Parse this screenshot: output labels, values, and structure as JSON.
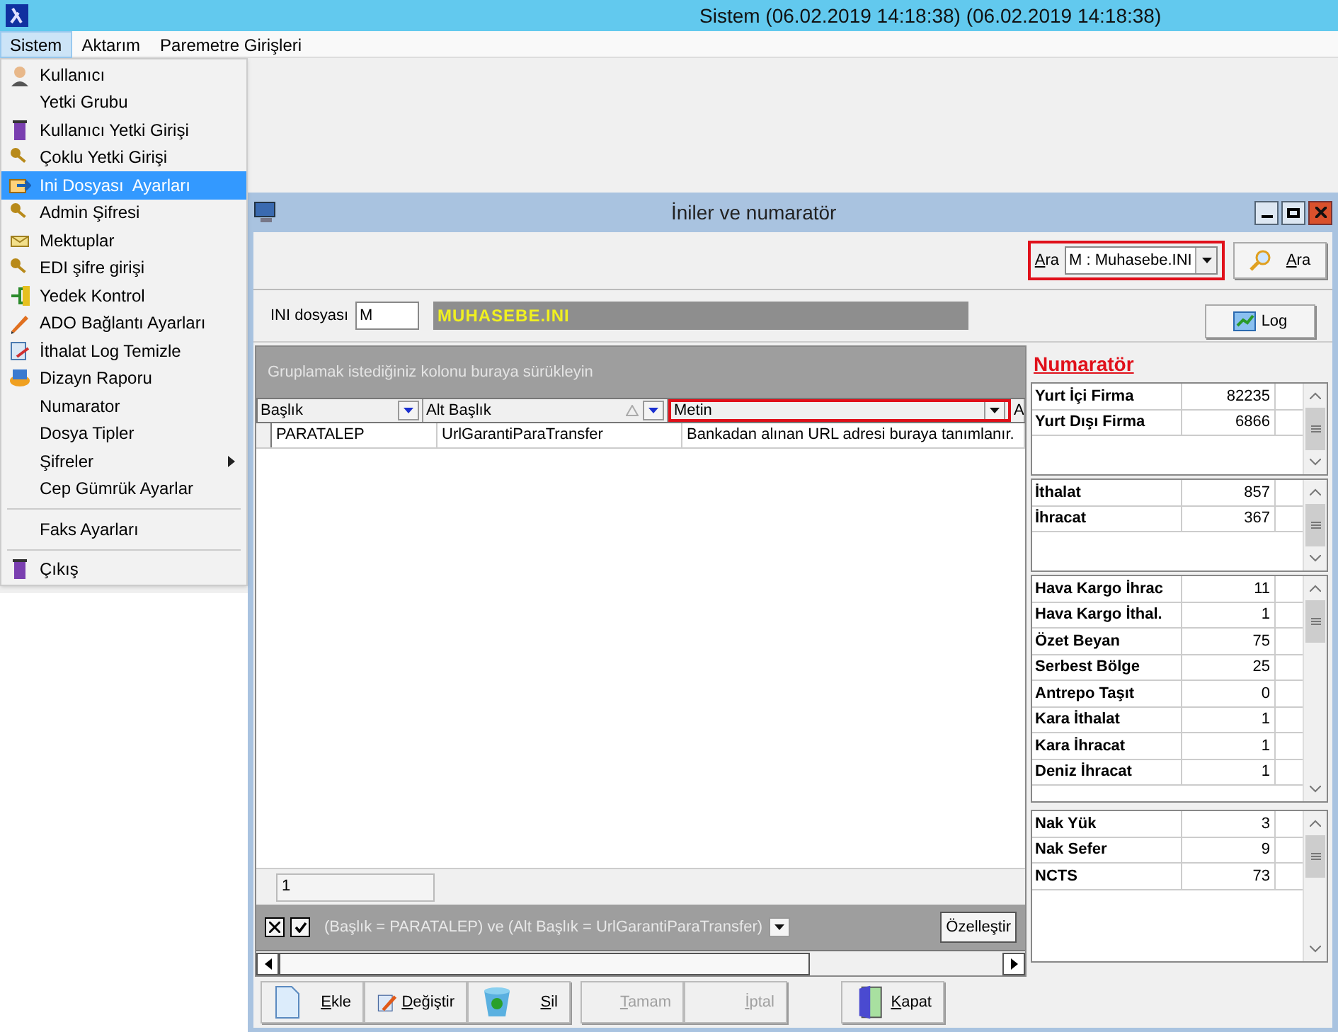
{
  "title_bar": {
    "title": "Sistem (06.02.2019 14:18:38) (06.02.2019 14:18:38)"
  },
  "menu_bar": [
    {
      "label": "Sistem",
      "selected": true
    },
    {
      "label": "Aktarım",
      "selected": false
    },
    {
      "label": "Paremetre Girişleri",
      "selected": false
    }
  ],
  "dropdown_menu": [
    {
      "kind": "item",
      "label": "Kullanıcı",
      "selected": false,
      "submenu": false
    },
    {
      "kind": "item",
      "label": "Yetki Grubu",
      "selected": false,
      "submenu": false
    },
    {
      "kind": "item",
      "label": "Kullanıcı Yetki Girişi",
      "selected": false,
      "submenu": false
    },
    {
      "kind": "item",
      "label": "Çoklu Yetki Girişi",
      "selected": false,
      "submenu": false
    },
    {
      "kind": "item",
      "label": "Ini Dosyası  Ayarları",
      "selected": true,
      "submenu": false
    },
    {
      "kind": "item",
      "label": "Admin Şifresi",
      "selected": false,
      "submenu": false
    },
    {
      "kind": "item",
      "label": "Mektuplar",
      "selected": false,
      "submenu": false
    },
    {
      "kind": "item",
      "label": "EDI şifre girişi",
      "selected": false,
      "submenu": false
    },
    {
      "kind": "item",
      "label": "Yedek Kontrol",
      "selected": false,
      "submenu": false
    },
    {
      "kind": "item",
      "label": "ADO Bağlantı Ayarları",
      "selected": false,
      "submenu": false
    },
    {
      "kind": "item",
      "label": "İthalat Log Temizle",
      "selected": false,
      "submenu": false
    },
    {
      "kind": "item",
      "label": "Dizayn Raporu",
      "selected": false,
      "submenu": false
    },
    {
      "kind": "item",
      "label": "Numarator",
      "selected": false,
      "submenu": false
    },
    {
      "kind": "item",
      "label": "Dosya Tipler",
      "selected": false,
      "submenu": false
    },
    {
      "kind": "item",
      "label": "Şifreler",
      "selected": false,
      "submenu": true
    },
    {
      "kind": "item",
      "label": "Cep Gümrük Ayarlar",
      "selected": false,
      "submenu": false
    },
    {
      "kind": "separator"
    },
    {
      "kind": "item",
      "label": "Faks Ayarları",
      "selected": false,
      "submenu": false
    },
    {
      "kind": "separator"
    },
    {
      "kind": "item",
      "label": "Çıkış",
      "selected": false,
      "submenu": false
    }
  ],
  "child_window": {
    "title": "İniler ve numaratör",
    "search": {
      "label": "Ara",
      "value": "M : Muhasebe.INI",
      "highlighted": true
    },
    "search_button": "Ara",
    "ini_label": "INI dosyası",
    "ini_value": "M",
    "ini_name": "MUHASEBE.INI",
    "log_button": "Log",
    "grid": {
      "group_hint": "Gruplamak istediğiniz kolonu buraya sürükleyin",
      "columns": [
        {
          "label": "Başlık",
          "highlighted": false
        },
        {
          "label": "Alt Başlık",
          "highlighted": false,
          "sorted": true
        },
        {
          "label": "Metin",
          "highlighted": true
        },
        {
          "label": "A",
          "highlighted": false
        }
      ],
      "rows": [
        [
          "PARATALEP",
          "UrlGarantiParaTransfer",
          "Bankadan alınan URL adresi buraya tanımlanır."
        ]
      ],
      "footer_count": "1",
      "filter": {
        "checked": true,
        "text": "(Başlık = PARATALEP) ve (Alt Başlık = UrlGarantiParaTransfer)"
      },
      "customize_button": "Özelleştir"
    },
    "numerator": {
      "title": "Numaratör",
      "groups": [
        {
          "rows": [
            {
              "name": "Yurt İçi Firma",
              "value": "82235"
            },
            {
              "name": "Yurt Dışı Firma",
              "value": "6866"
            }
          ]
        },
        {
          "rows": [
            {
              "name": "İthalat",
              "value": "857"
            },
            {
              "name": "İhracat",
              "value": "367"
            }
          ]
        },
        {
          "rows": [
            {
              "name": "Hava Kargo İhrac",
              "value": "11"
            },
            {
              "name": "Hava Kargo İthal.",
              "value": "1"
            },
            {
              "name": "Özet Beyan",
              "value": "75"
            },
            {
              "name": "Serbest Bölge",
              "value": "25"
            },
            {
              "name": "Antrepo Taşıt",
              "value": "0"
            },
            {
              "name": "Kara İthalat",
              "value": "1"
            },
            {
              "name": "Kara İhracat",
              "value": "1"
            },
            {
              "name": "Deniz İhracat",
              "value": "1"
            }
          ]
        },
        {
          "rows": [
            {
              "name": "Nak Yük",
              "value": "3"
            },
            {
              "name": "Nak Sefer",
              "value": "9"
            },
            {
              "name": "NCTS",
              "value": "73"
            }
          ]
        }
      ]
    },
    "buttons": [
      {
        "label": "Ekle",
        "disabled": false
      },
      {
        "label": "Değiştir",
        "disabled": false
      },
      {
        "label": "Sil",
        "disabled": false
      },
      {
        "label": "Tamam",
        "disabled": true
      },
      {
        "label": "İptal",
        "disabled": true
      },
      {
        "label": "Kapat",
        "disabled": false
      }
    ]
  }
}
